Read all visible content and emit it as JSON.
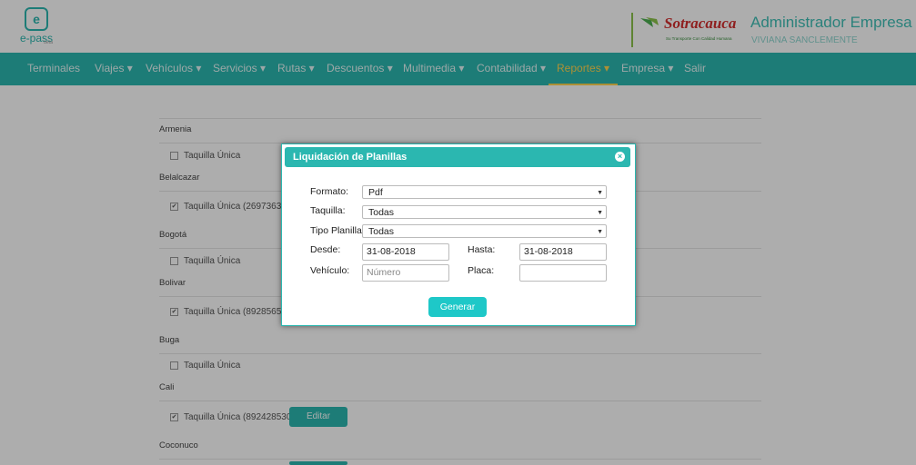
{
  "app": {
    "logo_text": "e-pass",
    "logo_sub": "beta",
    "brand": "Sotracauca",
    "brand_tagline": "Su Transporte Con Calidad Humana",
    "admin_title": "Administrador Empresa",
    "user_name": "VIVIANA SANCLEMENTE"
  },
  "nav": {
    "items": [
      {
        "label": "Terminales"
      },
      {
        "label": "Viajes ▾"
      },
      {
        "label": "Vehículos ▾"
      },
      {
        "label": "Servicios ▾"
      },
      {
        "label": "Rutas ▾"
      },
      {
        "label": "Descuentos ▾"
      },
      {
        "label": "Multimedia ▾"
      },
      {
        "label": "Contabilidad ▾"
      },
      {
        "label": "Reportes ▾"
      },
      {
        "label": "Empresa ▾"
      },
      {
        "label": "Salir"
      }
    ],
    "active_index": 8
  },
  "content": {
    "cities": [
      {
        "name": "Armenia",
        "taquilla": "Taquilla Única",
        "checked": false
      },
      {
        "name": "Belalcazar",
        "taquilla": "Taquilla Única (269736314",
        "checked": true
      },
      {
        "name": "Bogotá",
        "taquilla": "Taquilla Única",
        "checked": false
      },
      {
        "name": "Bolivar",
        "taquilla": "Taquilla Única (8928565376",
        "checked": true
      },
      {
        "name": "Buga",
        "taquilla": "Taquilla Única",
        "checked": false
      },
      {
        "name": "Cali",
        "taquilla": "Taquilla Única (8924285303)",
        "checked": true
      },
      {
        "name": "Coconuco",
        "taquilla": "",
        "checked": false
      }
    ],
    "edit_label": "Editar"
  },
  "dialog": {
    "title": "Liquidación de Planillas",
    "close_icon": "×",
    "formato_label": "Formato:",
    "formato_value": "Pdf",
    "taquilla_label": "Taquilla:",
    "taquilla_value": "Todas",
    "tipo_label": "Tipo Planilla:",
    "tipo_value": "Todas",
    "desde_label": "Desde:",
    "desde_value": "31-08-2018",
    "hasta_label": "Hasta:",
    "hasta_value": "31-08-2018",
    "vehiculo_label": "Vehículo:",
    "vehiculo_placeholder": "Número",
    "placa_label": "Placa:",
    "placa_value": "",
    "generate_label": "Generar"
  },
  "colors": {
    "accent": "#2bb7b0",
    "active_nav": "#ffd54f",
    "brand_red": "#d32f2f"
  }
}
